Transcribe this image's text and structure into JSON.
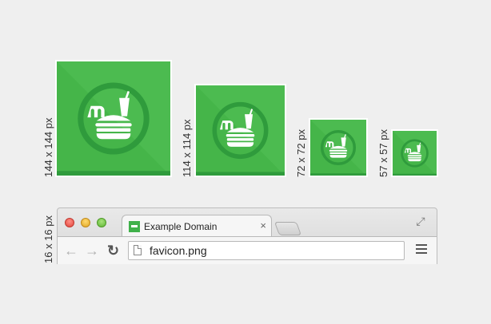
{
  "icons": [
    {
      "size_label": "144 x 144 px"
    },
    {
      "size_label": "114 x 114 px"
    },
    {
      "size_label": "72 x 72 px"
    },
    {
      "size_label": "57 x 57 px"
    }
  ],
  "favicon": {
    "size_label": "16 x 16 px"
  },
  "browser": {
    "tab_title": "Example Domain",
    "tab_close": "×",
    "url": "favicon.png",
    "back_icon": "←",
    "forward_icon": "→",
    "reload_icon": "↻",
    "fullscreen_icon": "⤢"
  },
  "colors": {
    "tile_green": "#45b549",
    "tile_dark": "#2f9b3c",
    "background": "#efefef"
  }
}
